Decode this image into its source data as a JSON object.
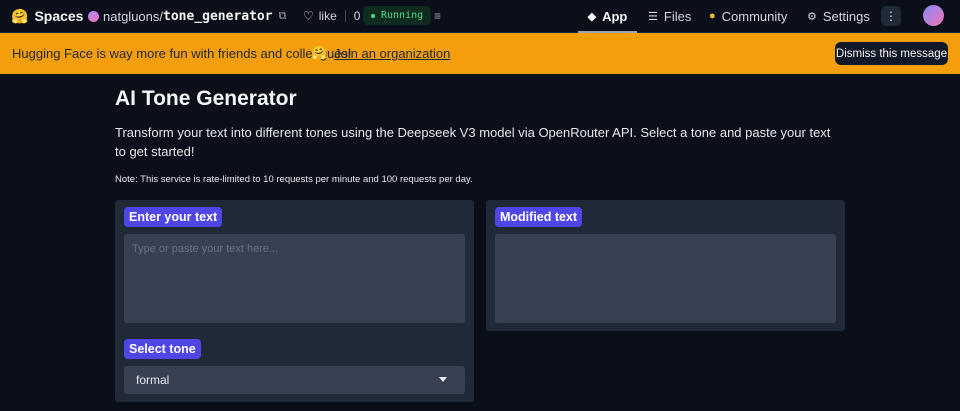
{
  "nav": {
    "brand": "Spaces",
    "brand_emoji": "🤗",
    "owner": "natgluons",
    "separator": "/",
    "repo": "tone_generator",
    "like_label": "like",
    "like_count": "0",
    "status": "Running",
    "tabs": [
      {
        "label": "App",
        "icon": "cube-icon",
        "glyph": "◆"
      },
      {
        "label": "Files",
        "icon": "files-icon",
        "glyph": "☰"
      },
      {
        "label": "Community",
        "icon": "community-icon",
        "glyph": "●"
      },
      {
        "label": "Settings",
        "icon": "gear-icon",
        "glyph": "⚙"
      }
    ]
  },
  "banner": {
    "text": "Hugging Face is way more fun with friends and colleagues!",
    "emoji": "🤗",
    "link": "Join an organization",
    "dismiss": "Dismiss this message"
  },
  "main": {
    "title": "AI Tone Generator",
    "description": "Transform your text into different tones using the Deepseek V3 model via OpenRouter API. Select a tone and paste your text to get started!",
    "note": "Note: This service is rate-limited to 10 requests per minute and 100 requests per day.",
    "input_label": "Enter your text",
    "input_value": "",
    "input_placeholder": "Type or paste your text here...",
    "tone_label": "Select tone",
    "tone_value": "formal",
    "output_label": "Modified text",
    "output_value": ""
  },
  "colors": {
    "background": "#0b0f19",
    "banner": "#f59e0b",
    "accent": "#4f46e5",
    "panel": "#1f2937",
    "field": "#374151",
    "running": "#4ade80"
  }
}
